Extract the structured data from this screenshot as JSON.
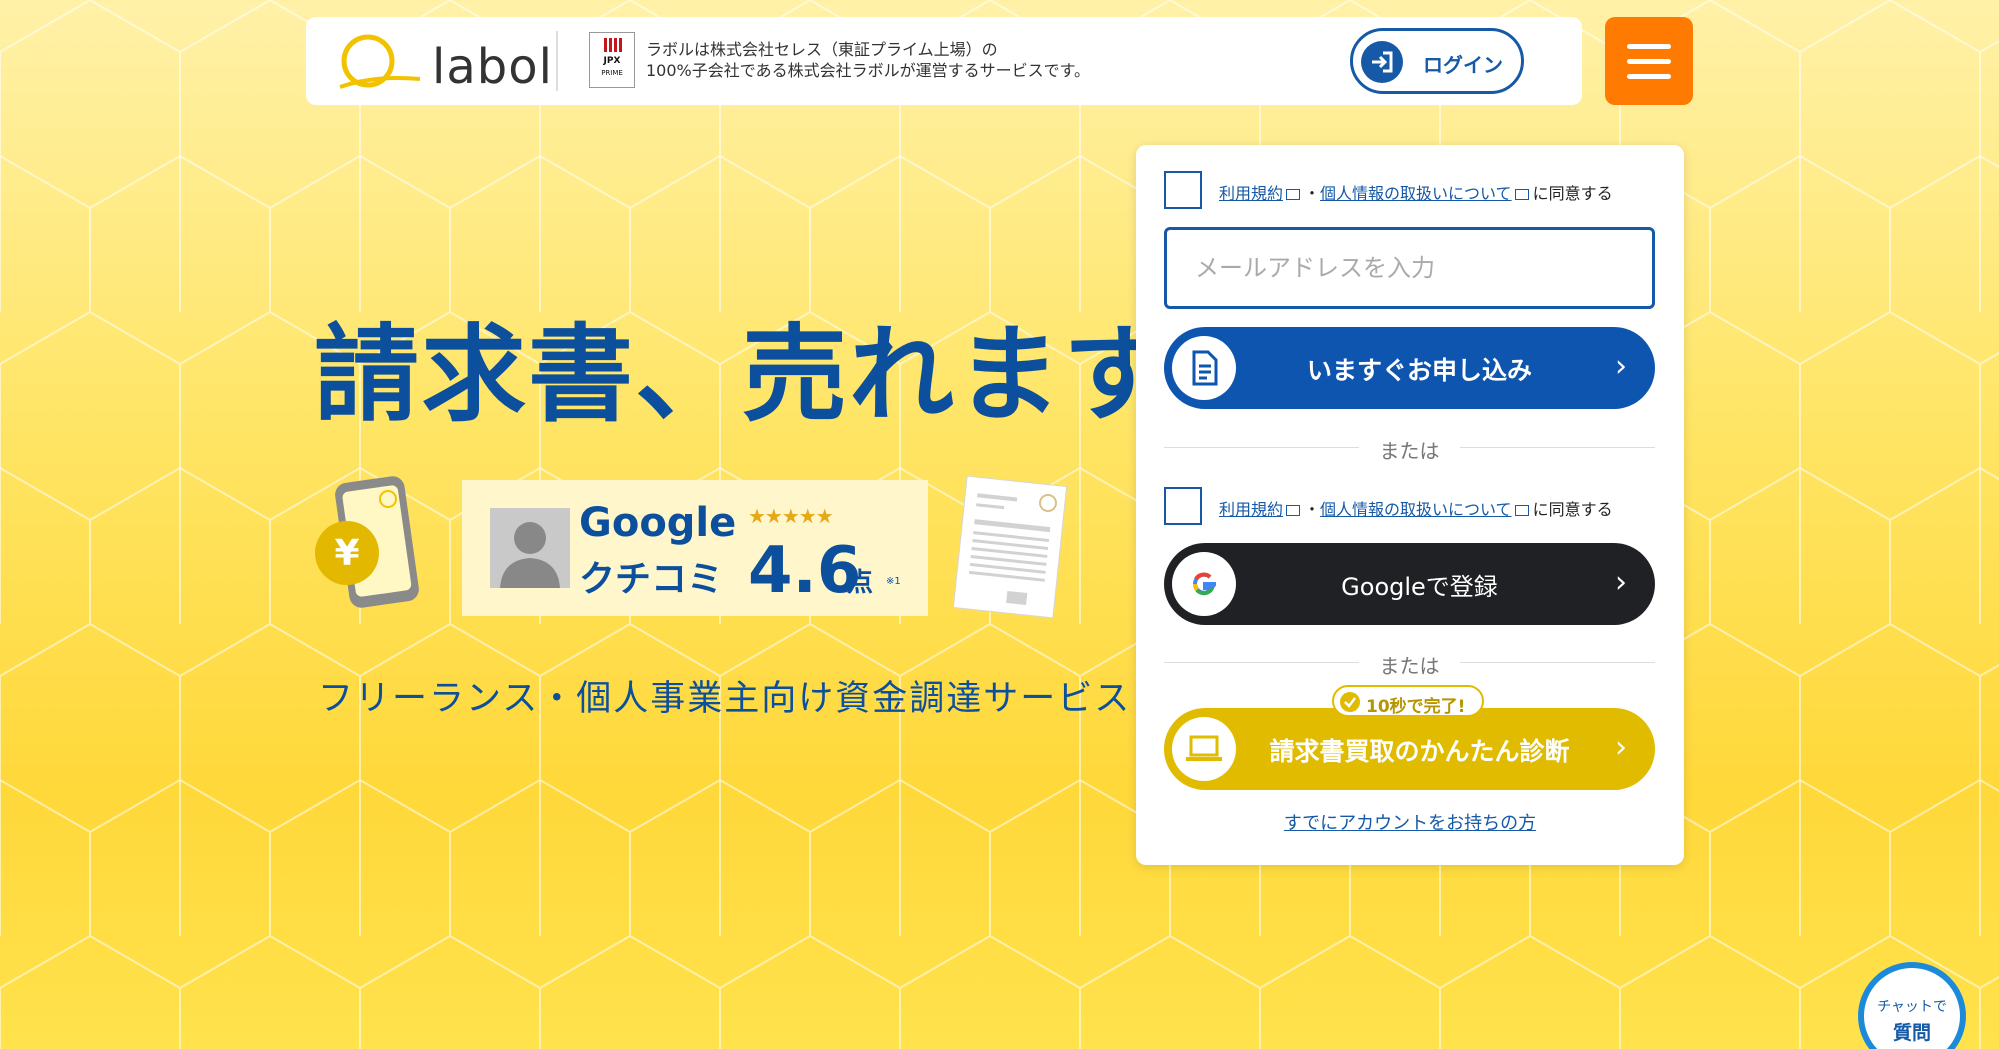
{
  "header": {
    "logo_text": "labol",
    "jpx": {
      "line1": "JPX",
      "line2": "PRIME"
    },
    "note_line1": "ラボルは株式会社セレス（東証プライム上場）の",
    "note_line2": "100%子会社である株式会社ラボルが運営するサービスです。",
    "login_label": "ログイン",
    "login_icon": "login-arrow-icon",
    "menu_icon": "hamburger-menu-icon"
  },
  "hero": {
    "headline": "請求書、売れます",
    "review": {
      "google": "Google",
      "stars": "★★★★★",
      "kuchikomi": "クチコミ",
      "score": "4.6",
      "unit": "点",
      "note": "※1"
    },
    "subcopy": "フリーランス・個人事業主向け資金調達サービス"
  },
  "form": {
    "terms_link": "利用規約",
    "separator": "・",
    "privacy_link": "個人情報の取扱いについて",
    "agree_suffix": "に同意する",
    "email_placeholder": "メールアドレスを入力",
    "apply_label": "いますぐお申し込み",
    "or_label": "または",
    "google_label": "Googleで登録",
    "badge_label": "10秒で完了!",
    "diagnosis_label": "請求書買取のかんたん診断",
    "have_account": "すでにアカウントをお持ちの方"
  },
  "chat": {
    "line1": "チャットで",
    "line2": "質問"
  },
  "colors": {
    "brand_blue": "#0c4f9c",
    "accent_orange": "#ff7a00",
    "diagnosis_yellow": "#e1bb00",
    "google_dark": "#202124"
  }
}
